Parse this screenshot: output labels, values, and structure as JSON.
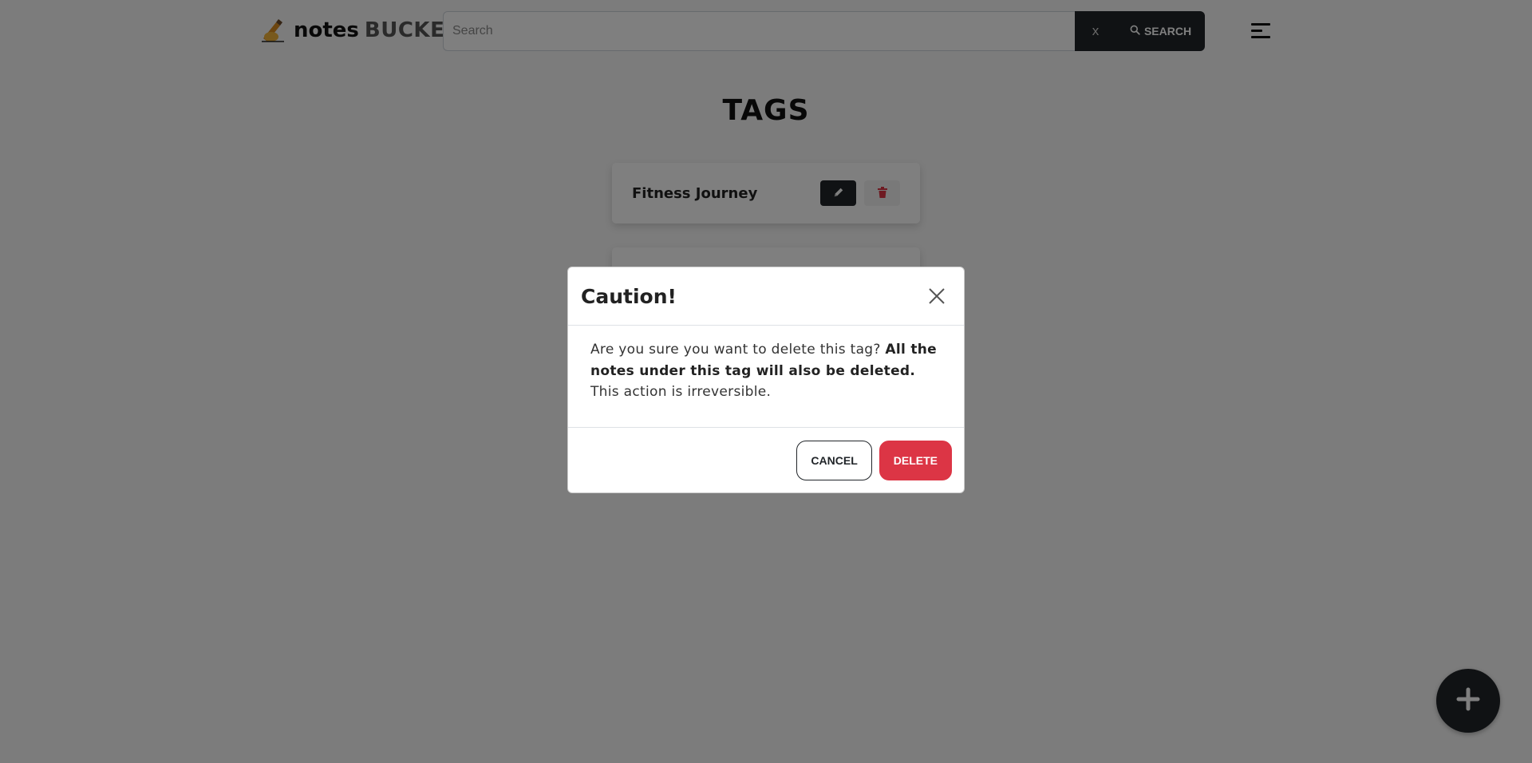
{
  "header": {
    "brand_notes": "notes",
    "brand_bucket": "BUCKET",
    "search_placeholder": "Search",
    "clear_label": "x",
    "search_label": "SEARCH"
  },
  "main": {
    "title": "TAGS",
    "tags": [
      {
        "name": "Fitness Journey"
      },
      {
        "name": ""
      }
    ]
  },
  "modal": {
    "title": "Caution!",
    "body_text_1": "Are you sure you want to delete this tag? ",
    "body_bold": "All the notes under this tag will also be deleted.",
    "body_text_2": " This action is irreversible.",
    "cancel_label": "CANCEL",
    "delete_label": "DELETE"
  },
  "colors": {
    "dark": "#212529",
    "danger": "#dc3545",
    "page_bg": "#f8f8f8",
    "backdrop": "rgba(0,0,0,0.5)"
  },
  "icons": {
    "brand": "writing-hand-icon",
    "search": "search-icon",
    "menu": "hamburger-menu-icon",
    "edit": "pencil-icon",
    "delete": "trash-icon",
    "close": "close-icon",
    "add": "plus-icon"
  }
}
